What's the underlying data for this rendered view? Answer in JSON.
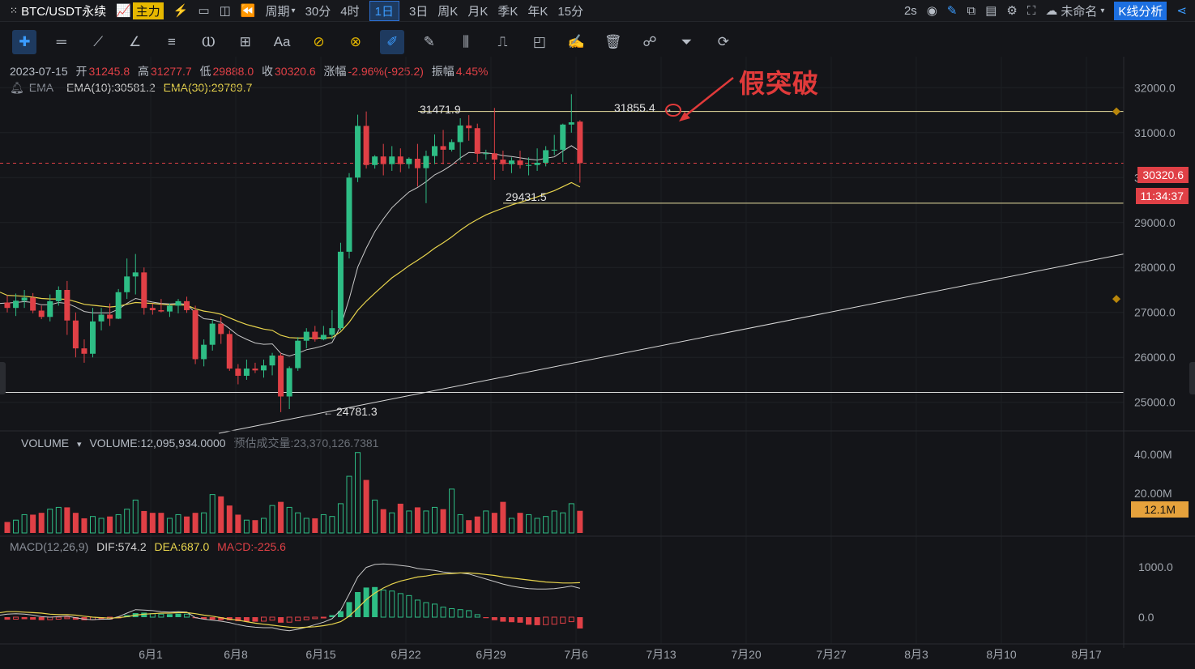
{
  "toolbar": {
    "symbol": "BTC/USDT永续",
    "main_label": "主力",
    "period_label": "周期",
    "intervals": [
      "30分",
      "4时",
      "1日",
      "3日",
      "周K",
      "月K",
      "季K",
      "年K",
      "15分"
    ],
    "active_interval": "1日",
    "refresh": "2s",
    "layout_name": "未命名",
    "analysis_button": "K线分析"
  },
  "drawing_tools": [
    "crosshair-icon",
    "horizontal-ray-icon",
    "trend-line-icon",
    "angle-icon",
    "parallel-channel-icon",
    "wave-icon",
    "measure-icon",
    "text-icon",
    "ruler-icon",
    "magnet-icon",
    "pencil-icon",
    "brush-icon",
    "bars-icon",
    "bucket-icon",
    "square-icon",
    "notes-icon",
    "trash-icon",
    "link-icon",
    "filter-icon",
    "sync-icon"
  ],
  "ohlc": {
    "date": "2023-07-15",
    "open_label": "开",
    "open": "31245.8",
    "high_label": "高",
    "high": "31277.7",
    "low_label": "低",
    "low": "29888.0",
    "close_label": "收",
    "close": "30320.6",
    "change_label": "涨幅",
    "change": "-2.96%(-925.2)",
    "amp_label": "振幅",
    "amp": "4.45%"
  },
  "ema": {
    "name": "EMA",
    "ema10": "EMA(10):30581.2",
    "ema30": "EMA(30):29789.7"
  },
  "volume_info": {
    "name": "VOLUME",
    "value": "VOLUME:12,095,934.0000",
    "estimate": "预估成交量:23,370,126.7381"
  },
  "macd_info": {
    "name": "MACD(12,26,9)",
    "dif": "DIF:574.2",
    "dea": "DEA:687.0",
    "macd": "MACD:-225.6"
  },
  "annotation": "假突破",
  "markers": {
    "high1": "31471.9",
    "high2": "31855.4",
    "low1": "29431.5",
    "low2": "24781.3"
  },
  "current_price": "30320.6",
  "countdown": "11:34:37",
  "volume_current": "12.1M",
  "colors": {
    "up": "#2ebd85",
    "down": "#e04046",
    "ema10": "#c8c8c8",
    "ema30": "#e8d44d",
    "accent": "#3b9cff"
  },
  "chart_data": {
    "type": "candlestick",
    "price_axis": {
      "ticks": [
        "32000.0",
        "31000.0",
        "30000.0",
        "29000.0",
        "28000.0",
        "27000.0",
        "26000.0",
        "25000.0"
      ],
      "ylim": [
        24400,
        32600
      ]
    },
    "volume_axis": {
      "ticks": [
        "40.00M",
        "20.00M"
      ]
    },
    "macd_axis": {
      "ticks": [
        "1000.0",
        "0.0"
      ]
    },
    "x_labels": [
      "6月1",
      "6月8",
      "6月15",
      "6月22",
      "6月29",
      "7月6",
      "7月13",
      "7月20",
      "7月27",
      "8月3",
      "8月10",
      "8月17"
    ],
    "candles": [
      [
        27220,
        27380,
        27000,
        27100
      ],
      [
        27100,
        27420,
        26920,
        27260
      ],
      [
        27260,
        27500,
        27100,
        27330
      ],
      [
        27330,
        27430,
        26980,
        27040
      ],
      [
        27040,
        27150,
        26850,
        26900
      ],
      [
        26900,
        27400,
        26800,
        27250
      ],
      [
        27250,
        27580,
        27150,
        27500
      ],
      [
        27500,
        27700,
        26500,
        26820
      ],
      [
        26820,
        27000,
        26000,
        26200
      ],
      [
        26200,
        26400,
        25880,
        26080
      ],
      [
        26080,
        27100,
        26000,
        26800
      ],
      [
        26800,
        27100,
        26600,
        26950
      ],
      [
        26950,
        27200,
        26700,
        26860
      ],
      [
        26860,
        27520,
        26850,
        27450
      ],
      [
        27450,
        28200,
        27300,
        27800
      ],
      [
        27800,
        28300,
        27400,
        27890
      ],
      [
        27890,
        28000,
        26950,
        27100
      ],
      [
        27100,
        27200,
        26950,
        27050
      ],
      [
        27050,
        27300,
        27000,
        27020
      ],
      [
        27020,
        27200,
        26900,
        27150
      ],
      [
        27150,
        27300,
        26980,
        27250
      ],
      [
        27250,
        27350,
        26990,
        27050
      ],
      [
        27050,
        27150,
        25850,
        25960
      ],
      [
        25960,
        26400,
        25800,
        26280
      ],
      [
        26280,
        26850,
        26150,
        26750
      ],
      [
        26750,
        26900,
        26300,
        26520
      ],
      [
        26520,
        26600,
        25700,
        25750
      ],
      [
        25750,
        25850,
        25400,
        25590
      ],
      [
        25590,
        25950,
        25500,
        25750
      ],
      [
        25750,
        25880,
        25650,
        25710
      ],
      [
        25710,
        25950,
        25550,
        25820
      ],
      [
        25820,
        26100,
        25600,
        26040
      ],
      [
        26040,
        26100,
        24781,
        25130
      ],
      [
        25130,
        25800,
        24850,
        25760
      ],
      [
        25760,
        26450,
        25700,
        26370
      ],
      [
        26370,
        26650,
        26200,
        26570
      ],
      [
        26570,
        26700,
        26350,
        26400
      ],
      [
        26400,
        26700,
        26380,
        26500
      ],
      [
        26500,
        27050,
        26400,
        26650
      ],
      [
        26650,
        28550,
        26600,
        28350
      ],
      [
        28350,
        30100,
        28200,
        30000
      ],
      [
        30000,
        31400,
        29900,
        31150
      ],
      [
        31150,
        31471,
        30200,
        30280
      ],
      [
        30280,
        30500,
        30200,
        30470
      ],
      [
        30470,
        30750,
        30050,
        30300
      ],
      [
        30300,
        30700,
        30150,
        30470
      ],
      [
        30470,
        30650,
        30120,
        30300
      ],
      [
        30300,
        30450,
        30200,
        30420
      ],
      [
        30420,
        30750,
        29800,
        30210
      ],
      [
        30210,
        30600,
        29431,
        30480
      ],
      [
        30480,
        30960,
        30300,
        30700
      ],
      [
        30700,
        31060,
        30300,
        30620
      ],
      [
        30620,
        30850,
        30580,
        30790
      ],
      [
        30790,
        31320,
        30380,
        31160
      ],
      [
        31160,
        31390,
        30820,
        31100
      ],
      [
        31100,
        31200,
        30350,
        30530
      ],
      [
        30530,
        30620,
        30400,
        30540
      ],
      [
        30540,
        31550,
        29950,
        30400
      ],
      [
        30400,
        30600,
        30150,
        30300
      ],
      [
        30300,
        30450,
        30100,
        30380
      ],
      [
        30380,
        30600,
        30200,
        30280
      ],
      [
        30280,
        30450,
        30050,
        30280
      ],
      [
        30280,
        30650,
        30150,
        30330
      ],
      [
        30330,
        30700,
        30250,
        30610
      ],
      [
        30610,
        30950,
        30500,
        30620
      ],
      [
        30620,
        31200,
        30350,
        31180
      ],
      [
        31180,
        31855,
        31000,
        31230
      ],
      [
        31245.8,
        31277.7,
        29888,
        30320.6
      ]
    ],
    "volumes_M": [
      6,
      7,
      10,
      10,
      11,
      13,
      14,
      14,
      11,
      8,
      9,
      8,
      9,
      10,
      13,
      18,
      12,
      11,
      11,
      8,
      10,
      9,
      11,
      11,
      21,
      20,
      15,
      10,
      7,
      7,
      8,
      15,
      17,
      14,
      11,
      8,
      8,
      10,
      9,
      16,
      31,
      44,
      29,
      18,
      13,
      11,
      16,
      12,
      14,
      12,
      14,
      13,
      24,
      10,
      7,
      9,
      12,
      11,
      17,
      8,
      11,
      10,
      8,
      9,
      12,
      11,
      16,
      12.1
    ],
    "ema10": [
      27210,
      27220,
      27240,
      27220,
      27170,
      27170,
      27220,
      27200,
      27120,
      27020,
      26990,
      26990,
      26990,
      27070,
      27200,
      27310,
      27270,
      27230,
      27200,
      27190,
      27200,
      27180,
      26990,
      26860,
      26840,
      26780,
      26640,
      26490,
      26400,
      26320,
      26290,
      26300,
      26090,
      26030,
      26090,
      26170,
      26210,
      26260,
      26330,
      26690,
      27300,
      28010,
      28430,
      28800,
      29080,
      29330,
      29510,
      29680,
      29780,
      29910,
      30060,
      30160,
      30280,
      30440,
      30560,
      30550,
      30550,
      30530,
      30490,
      30470,
      30440,
      30410,
      30390,
      30430,
      30460,
      30590,
      30710,
      30581.2
    ],
    "ema30": [
      27380,
      27370,
      27360,
      27340,
      27310,
      27300,
      27300,
      27290,
      27240,
      27180,
      27160,
      27140,
      27120,
      27140,
      27180,
      27220,
      27210,
      27200,
      27180,
      27170,
      27170,
      27160,
      27080,
      27030,
      27000,
      26960,
      26880,
      26800,
      26730,
      26680,
      26630,
      26600,
      26490,
      26440,
      26430,
      26430,
      26430,
      26430,
      26440,
      26570,
      26780,
      27050,
      27250,
      27430,
      27600,
      27770,
      27900,
      28040,
      28160,
      28290,
      28430,
      28550,
      28680,
      28830,
      28960,
      29070,
      29170,
      29250,
      29320,
      29390,
      29450,
      29510,
      29570,
      29640,
      29710,
      29800,
      29890,
      29789.7
    ],
    "macd_hist": [
      -50,
      -40,
      -40,
      -50,
      -60,
      -50,
      -40,
      -30,
      -50,
      -60,
      -50,
      -50,
      -40,
      -10,
      40,
      80,
      90,
      70,
      60,
      60,
      70,
      60,
      -20,
      -40,
      -50,
      -60,
      -60,
      -80,
      -90,
      -90,
      -80,
      -60,
      -110,
      -100,
      -70,
      -50,
      -30,
      -10,
      40,
      120,
      300,
      500,
      590,
      600,
      540,
      520,
      470,
      430,
      340,
      290,
      260,
      200,
      170,
      150,
      130,
      50,
      -20,
      -60,
      -90,
      -100,
      -110,
      -150,
      -160,
      -150,
      -140,
      -120,
      -90,
      -225.6
    ],
    "macd_dif": [
      60,
      70,
      60,
      40,
      10,
      0,
      10,
      20,
      -10,
      -40,
      -50,
      -40,
      -40,
      10,
      80,
      150,
      140,
      130,
      110,
      100,
      110,
      100,
      -10,
      -40,
      -60,
      -80,
      -110,
      -150,
      -180,
      -200,
      -210,
      -210,
      -250,
      -270,
      -240,
      -200,
      -150,
      -100,
      -30,
      140,
      460,
      800,
      990,
      1050,
      1060,
      1050,
      1030,
      1010,
      970,
      950,
      930,
      900,
      880,
      880,
      860,
      810,
      760,
      710,
      660,
      620,
      590,
      570,
      560,
      560,
      570,
      590,
      620,
      574.2
    ],
    "macd_dea": [
      110,
      110,
      100,
      90,
      80,
      60,
      50,
      50,
      40,
      20,
      0,
      -10,
      -20,
      -10,
      10,
      40,
      60,
      70,
      80,
      80,
      90,
      90,
      70,
      40,
      20,
      -10,
      -40,
      -60,
      -90,
      -120,
      -140,
      -160,
      -180,
      -200,
      -210,
      -200,
      -190,
      -170,
      -140,
      -90,
      20,
      180,
      350,
      480,
      580,
      660,
      720,
      760,
      800,
      820,
      850,
      860,
      870,
      880,
      880,
      870,
      850,
      830,
      800,
      780,
      760,
      740,
      720,
      700,
      690,
      680,
      680,
      687.0
    ]
  }
}
